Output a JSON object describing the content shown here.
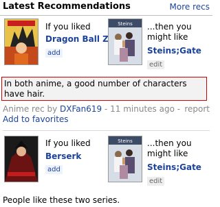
{
  "header": {
    "title": "Latest Recommendations",
    "more_link": "More recs"
  },
  "recs": [
    {
      "liked_label": "If you liked",
      "liked_title": "Dragon Ball Z",
      "add_label": "add",
      "then_label": "...then you might like",
      "like_title": "Steins;Gate",
      "edit_label": "edit",
      "reason": "In both anime, a good number of characters have hair.",
      "meta_prefix": "Anime rec by",
      "author": "DXFan619",
      "time": "- 11 minutes ago -",
      "report_label": "report",
      "favorites_label": "Add to favorites"
    },
    {
      "liked_label": "If you liked",
      "liked_title": "Berserk",
      "add_label": "add",
      "then_label": "...then you might like",
      "like_title": "Steins;Gate",
      "edit_label": "edit",
      "reason": "People like these two series."
    }
  ],
  "colors": {
    "link": "#1c439b",
    "reason_border": "#cc0000"
  }
}
